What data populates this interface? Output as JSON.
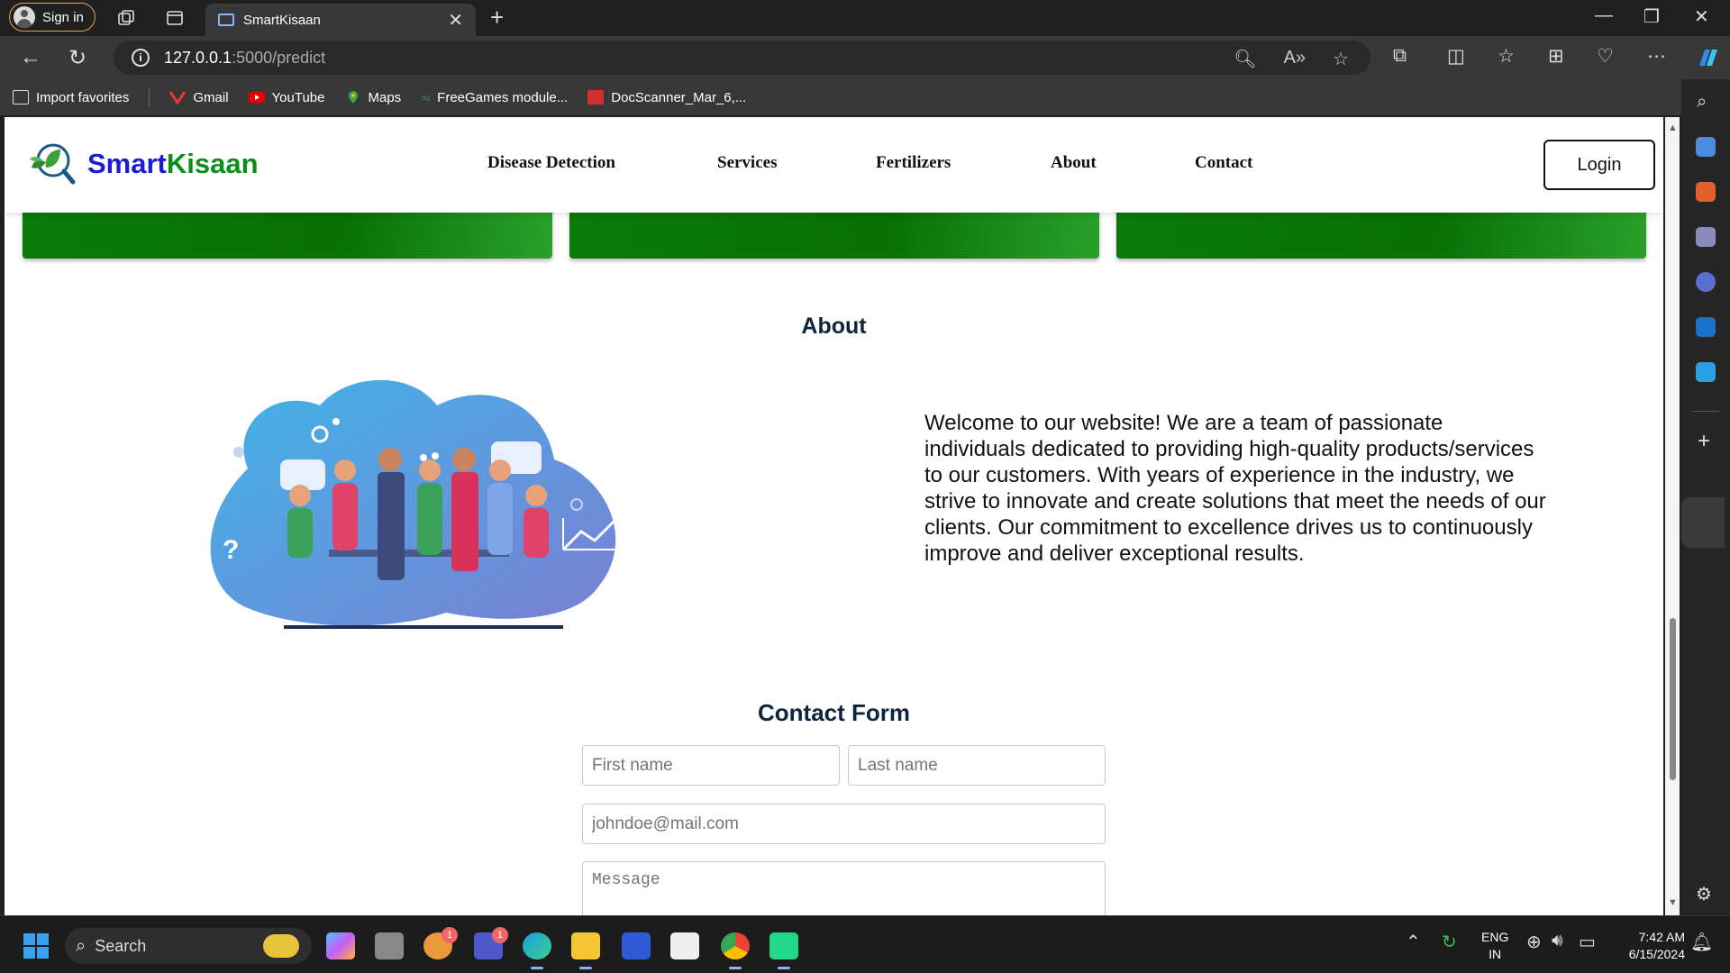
{
  "browser": {
    "signin_label": "Sign in",
    "tab_title": "SmartKisaan",
    "url_host": "127.0.0.1",
    "url_path": ":5000/predict",
    "bookmarks": [
      "Import favorites",
      "Gmail",
      "YouTube",
      "Maps",
      "FreeGames module...",
      "DocScanner_Mar_6,..."
    ]
  },
  "site": {
    "brand_part1": "Smart",
    "brand_part2": "Kisaan",
    "nav": [
      "Disease Detection",
      "Services",
      "Fertilizers",
      "About",
      "Contact"
    ],
    "login_label": "Login"
  },
  "about": {
    "title": "About",
    "text": "Welcome to our website! We are a team of passionate individuals dedicated to providing high-quality products/services to our customers. With years of experience in the industry, we strive to innovate and create solutions that meet the needs of our clients. Our commitment to excellence drives us to continuously improve and deliver exceptional results."
  },
  "contact": {
    "title": "Contact Form",
    "first_name_placeholder": "First name",
    "last_name_placeholder": "Last name",
    "email_placeholder": "johndoe@mail.com",
    "message_placeholder": "Message"
  },
  "taskbar": {
    "search_label": "Search",
    "lang_line1": "ENG",
    "lang_line2": "IN",
    "time": "7:42 AM",
    "date": "6/15/2024",
    "badge_count_1": "1",
    "badge_count_2": "1"
  },
  "colors": {
    "brand_blue": "#1a1ad8",
    "brand_green": "#0a8f1a",
    "card_green": "#0a7a0a",
    "heading_navy": "#0d2440"
  }
}
